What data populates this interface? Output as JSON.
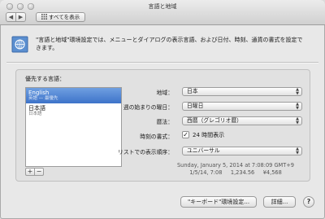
{
  "window": {
    "title": "言語と地域"
  },
  "toolbar": {
    "back_glyph": "◀",
    "forward_glyph": "▶",
    "show_all_label": "すべてを表示",
    "grid_icon": "grid-icon"
  },
  "header": {
    "icon": "un-flag-icon",
    "description": "\"言語と地域\"環境設定では、メニューとダイアログの表示言語、および日付、時刻、通貨の書式を設定できます。"
  },
  "languages": {
    "label": "優先する言語：",
    "items": [
      {
        "name": "English",
        "sub": "英語 — 最優先"
      },
      {
        "name": "日本語",
        "sub": "日本語"
      }
    ],
    "add_label": "+",
    "remove_label": "−"
  },
  "settings": {
    "region_label": "地域：",
    "region_value": "日本",
    "first_day_label": "週の始まりの曜日：",
    "first_day_value": "日曜日",
    "calendar_label": "暦法：",
    "calendar_value": "西暦（グレゴリオ暦）",
    "time_format_label": "時刻の書式：",
    "time_format_checkbox": "24 時間表示",
    "time_format_checked": true,
    "sort_order_label": "リストでの表示順序：",
    "sort_order_value": "ユニバーサル"
  },
  "sample": {
    "line1": "Sunday, January 5, 2014 at 7:08:09 GMT+9",
    "line2": "1/5/14, 7:08     1,234.56     ¥4,568"
  },
  "footer": {
    "keyboard_prefs_label": "\"キーボード\"環境設定...",
    "advanced_label": "詳細...",
    "help_label": "?"
  }
}
